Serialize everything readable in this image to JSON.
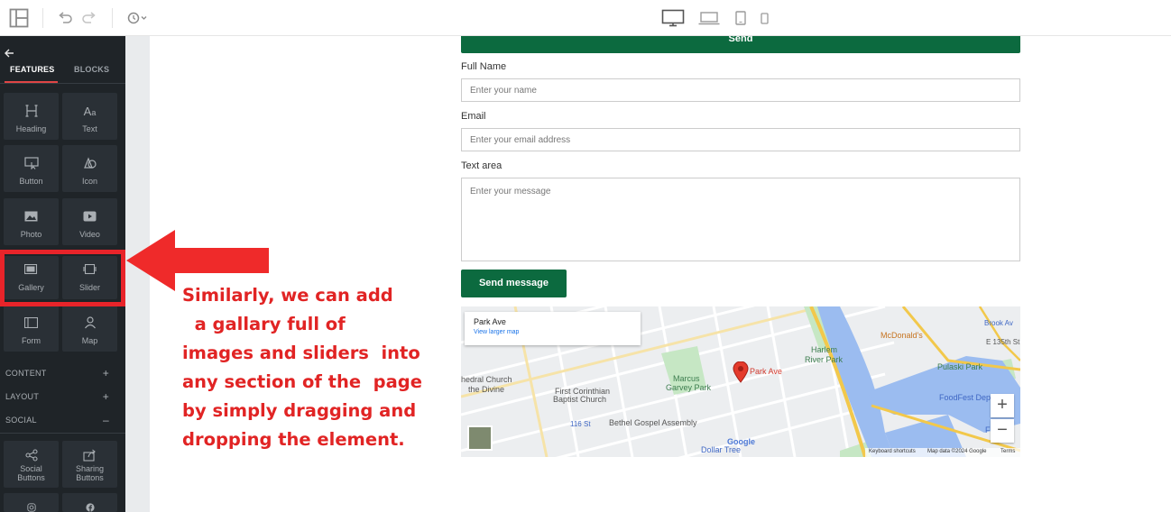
{
  "topbar": {
    "layout_icon": "layout-icon",
    "undo_icon": "undo-icon",
    "redo_icon": "redo-icon",
    "history_icon": "history-icon",
    "devices": [
      "desktop-icon",
      "laptop-icon",
      "tablet-icon",
      "mobile-icon"
    ]
  },
  "sidebar": {
    "back_icon": "arrow-left-icon",
    "tabs": {
      "features": "FEATURES",
      "blocks": "BLOCKS"
    },
    "tiles": [
      {
        "label": "Heading",
        "icon": "heading-icon"
      },
      {
        "label": "Text",
        "icon": "text-icon"
      },
      {
        "label": "Button",
        "icon": "button-icon"
      },
      {
        "label": "Icon",
        "icon": "shapes-icon"
      },
      {
        "label": "Photo",
        "icon": "photo-icon"
      },
      {
        "label": "Video",
        "icon": "video-icon"
      },
      {
        "label": "Gallery",
        "icon": "gallery-icon"
      },
      {
        "label": "Slider",
        "icon": "slider-icon"
      },
      {
        "label": "Form",
        "icon": "form-icon"
      },
      {
        "label": "Map",
        "icon": "map-icon"
      }
    ],
    "sections": [
      {
        "label": "CONTENT",
        "symbol": "+"
      },
      {
        "label": "LAYOUT",
        "symbol": "+"
      },
      {
        "label": "SOCIAL",
        "symbol": "–"
      }
    ],
    "social_tiles": [
      {
        "label1": "Social",
        "label2": "Buttons",
        "icon": "share-icon"
      },
      {
        "label1": "Sharing",
        "label2": "Buttons",
        "icon": "share-box-icon"
      },
      {
        "label1": "",
        "label2": "",
        "icon": "instagram-icon"
      },
      {
        "label1": "",
        "label2": "",
        "icon": "facebook-icon"
      }
    ]
  },
  "form": {
    "top_button": "Send",
    "full_name_label": "Full Name",
    "full_name_placeholder": "Enter your name",
    "email_label": "Email",
    "email_placeholder": "Enter your email address",
    "textarea_label": "Text area",
    "textarea_placeholder": "Enter your message",
    "submit_label": "Send message",
    "accent": "#0c6a3f"
  },
  "map": {
    "info_title": "Park Ave",
    "info_link": "View larger map",
    "pin_label": "Park Ave",
    "labels": {
      "marcus": [
        "Marcus",
        "Garvey Park"
      ],
      "harlem": [
        "Harlem",
        "River Park"
      ],
      "pulaski": "Pulaski Park",
      "mcdonalds": "McDonald's",
      "foodfest": "FoodFest Depot",
      "church1": [
        "hedral Church",
        "the Divine"
      ],
      "church2": [
        "First Corinthian",
        "Baptist Church"
      ],
      "bethel": "Bethel Gospel Assembly",
      "dollar": "Dollar Tree",
      "brook": "Brook Av",
      "e135": "E 135th St",
      "fresh": "Fresh",
      "station": "116 St",
      "google": "Google",
      "footer_shortcuts": "Keyboard shortcuts",
      "footer_data": "Map data ©2024 Google",
      "footer_terms": "Terms"
    },
    "zoom_in": "+",
    "zoom_out": "−"
  },
  "annotation": {
    "lines": [
      "Similarly, we can add",
      "  a gallary full of",
      "images and sliders  into",
      "any section of the  page",
      "by simply dragging and",
      "dropping the element."
    ],
    "color": "#e12424"
  }
}
